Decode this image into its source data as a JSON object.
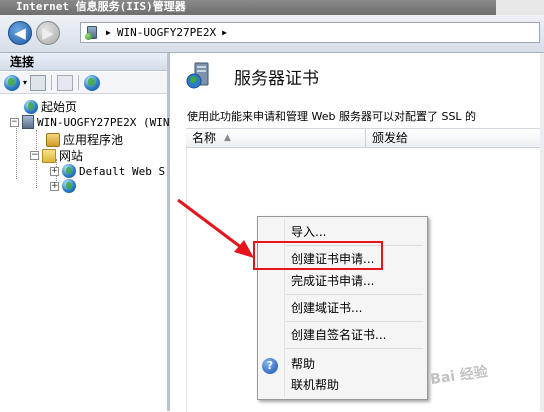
{
  "window": {
    "title": "Internet 信息服务(IIS)管理器"
  },
  "navigation": {
    "address_path": "WIN-UOGFY27PE2X",
    "address_arrow": "▶"
  },
  "connections": {
    "header": "连接",
    "tree": {
      "start_page": "起始页",
      "server": "WIN-UOGFY27PE2X (WIN",
      "app_pools": "应用程序池",
      "sites": "网站",
      "default_site": "Default Web S"
    }
  },
  "main": {
    "title": "服务器证书",
    "description": "使用此功能来申请和管理 Web 服务器可以对配置了 SSL 的",
    "columns": [
      "名称",
      "颁发给"
    ],
    "sort_indicator": "▲"
  },
  "context_menu": {
    "items": [
      "导入...",
      "创建证书申请...",
      "完成证书申请...",
      "创建域证书...",
      "创建自签名证书...",
      "帮助",
      "联机帮助"
    ]
  },
  "annotation": {
    "highlight_color": "#e5141d",
    "watermark": "Bai 经验"
  },
  "icons": {
    "back": "back-arrow-icon",
    "forward": "forward-arrow-icon",
    "help": "help-icon"
  }
}
